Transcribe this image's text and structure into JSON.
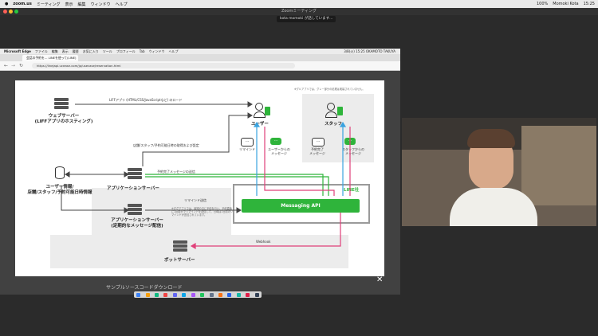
{
  "menubar": {
    "app": "zoom.us",
    "items": [
      "ミーティング",
      "表示",
      "編集",
      "ウィンドウ",
      "ヘルプ"
    ],
    "status": "100%",
    "user": "Momoki Kota",
    "clock": "15:25"
  },
  "zoom": {
    "title": "Zoomミーティング",
    "notice": "kota momoki が話しています..."
  },
  "browser": {
    "app": "Microsoft Edge",
    "menu": [
      "ファイル",
      "編集",
      "表示",
      "履歴",
      "お気に入り",
      "ツール",
      "プロフィール",
      "Tab",
      "ウィンドウ",
      "ヘルプ"
    ],
    "status_right": "3/8(火) 15:25  OKAMOTO TAKUYA",
    "tab_title": "会話の予約を... LINEを使って(LINE)",
    "url": "https://linejapi.ucease.com/jp/usecase/reservation.html"
  },
  "slide": {
    "note": "※グルアプリでは、グレー部分の処理は実装されていません。",
    "web_server": "ウェブサーバー\n(LIFFアプリのホスティング)",
    "liff_load": "LIFFアプリ (HTML/CSS/JavaScriptなど) のロード",
    "user": "ユーザー",
    "staff": "スタッフ",
    "reminder": "リマインド",
    "msg_from_user": "ユーザーからの\nメッセージ",
    "reservation_done": "予約完了\nメッセージ",
    "msg_from_staff": "スタッフからの\nメッセージ",
    "store_info": "店舗/スタッフ/予約可能日時の取得および設定",
    "db_label": "ユーザー情報/\n店舗/スタッフ/予約可能日時情報",
    "app_server": "アプリケーションサーバー",
    "reservation_send": "予約完了メッセージの送信",
    "reminder_send": "リマインド送信",
    "app_server_periodic": "アプリケーションサーバー\n(定期的なメッセージ配信)",
    "reminder_note": "※ダグアプリでは、最短の日に予約を行い、予約直後に1回自分でリマインドを送信して、日時は1日前のリマインドが送信されています。",
    "line_corp": "LINE社",
    "messaging_api": "Messaging API",
    "webhook": "Webhook",
    "bot_server": "ボットサーバー"
  },
  "below_slide": "サンプルソースコードダウンロード",
  "icons": [
    "database-icon",
    "server-icon",
    "person-icon",
    "chat-bubble-icon",
    "close-icon"
  ],
  "colors": {
    "line_green": "#2fb43b",
    "blue_arrow": "#3aa3e0",
    "pink_arrow": "#e0407a",
    "gray_box": "#e8e8e8"
  }
}
